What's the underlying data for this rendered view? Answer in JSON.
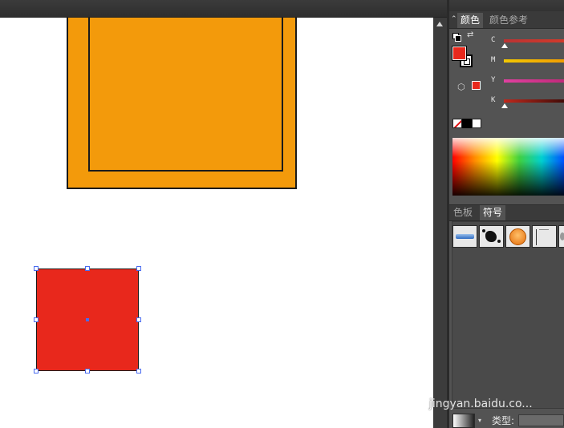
{
  "panel": {
    "tabs": [
      {
        "label": "颜色",
        "active": true
      },
      {
        "label": "颜色参考",
        "active": false
      }
    ],
    "sliders": [
      {
        "label": "C",
        "gradient": "#d33a2a"
      },
      {
        "label": "M",
        "gradient": "#f2b400"
      },
      {
        "label": "Y",
        "gradient": "#e040a0"
      },
      {
        "label": "K",
        "gradient": "#7a1a12"
      }
    ],
    "fill_color": "#e8281c"
  },
  "symbols": {
    "tabs": [
      {
        "label": "色板",
        "active": false
      },
      {
        "label": "符号",
        "active": true
      }
    ],
    "items": [
      "blue-bar-symbol",
      "ink-splat-symbol",
      "orange-circle-symbol",
      "vertical-line-symbol",
      "gray-blob-symbol"
    ]
  },
  "bottom": {
    "type_label": "类型:"
  },
  "watermark": {
    "text": "jingyan.baidu.co..."
  },
  "colors": {
    "orange": "#f39a0b",
    "red": "#e8281c"
  }
}
